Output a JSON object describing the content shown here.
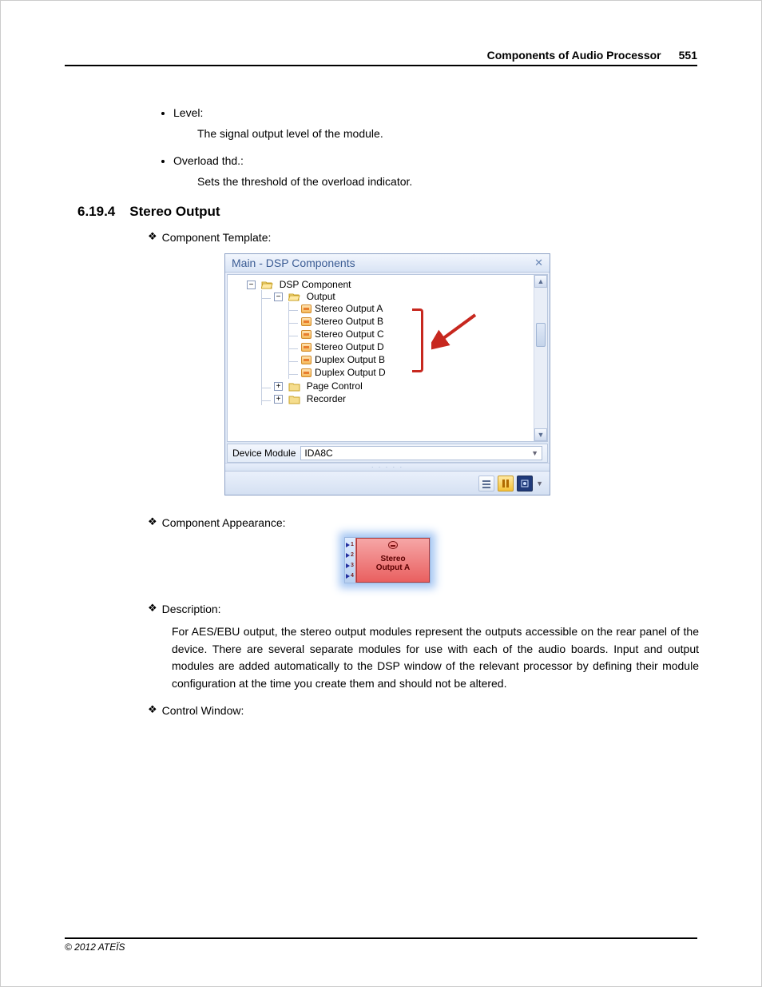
{
  "header": {
    "title": "Components of Audio Processor",
    "page": "551"
  },
  "bullets": [
    {
      "label": "Level:",
      "desc": "The signal output level of the module."
    },
    {
      "label": "Overload thd.:",
      "desc": "Sets the threshold of the overload indicator."
    }
  ],
  "section": {
    "num": "6.19.4",
    "title": "Stereo Output"
  },
  "labels": {
    "componentTemplate": "Component Template:",
    "componentAppearance": "Component Appearance:",
    "description": "Description:",
    "controlWindow": "Control Window:"
  },
  "tree": {
    "title": "Main - DSP Components",
    "root": "DSP Component",
    "output": "Output",
    "stereo": [
      "Stereo Output A",
      "Stereo Output B",
      "Stereo Output C",
      "Stereo Output D"
    ],
    "duplex": [
      "Duplex Output B",
      "Duplex Output D"
    ],
    "siblings": [
      "Page Control",
      "Recorder"
    ],
    "deviceLabel": "Device Module",
    "deviceValue": "IDA8C"
  },
  "component": {
    "line1": "Stereo",
    "line2": "Output A",
    "ports": [
      "1",
      "2",
      "3",
      "4"
    ]
  },
  "description_text": "For AES/EBU output, the stereo output modules represent the outputs accessible on the rear panel of the device. There are several separate modules for use with each of the audio boards. Input and output modules are added automatically to the DSP window of the relevant processor by defining their module configuration at the time you create them and should not be altered.",
  "footer": "© 2012 ATEÏS"
}
